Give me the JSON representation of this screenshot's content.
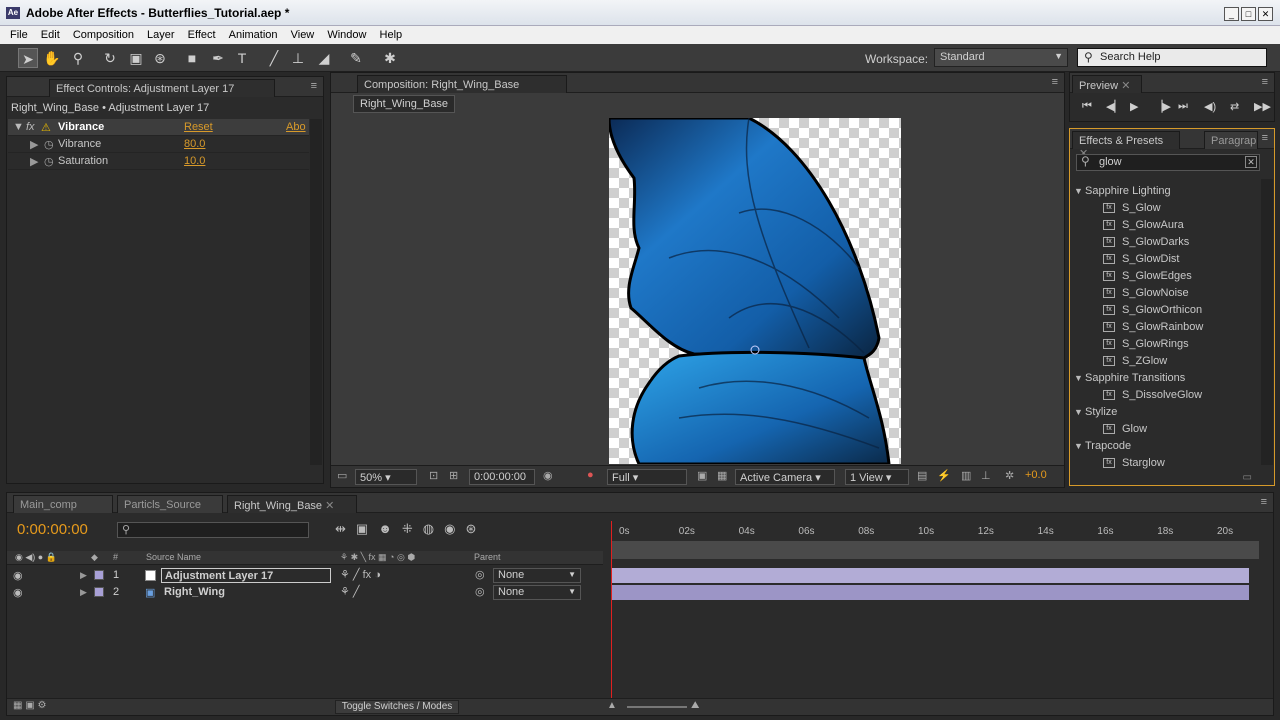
{
  "window": {
    "title": "Adobe After Effects - Butterflies_Tutorial.aep *",
    "app_icon": "Ae"
  },
  "menu": [
    "File",
    "Edit",
    "Composition",
    "Layer",
    "Effect",
    "Animation",
    "View",
    "Window",
    "Help"
  ],
  "toolbar": {
    "tools": [
      "selection-tool-icon",
      "hand-tool-icon",
      "zoom-tool-icon",
      "rotate-tool-icon",
      "camera-tool-icon",
      "pan-behind-tool-icon",
      "rectangle-tool-icon",
      "pen-tool-icon",
      "type-tool-icon",
      "brush-tool-icon",
      "clone-stamp-tool-icon",
      "eraser-tool-icon",
      "roto-brush-tool-icon",
      "puppet-pin-tool-icon"
    ],
    "workspace_label": "Workspace:",
    "workspace_value": "Standard",
    "search_placeholder": "Search Help"
  },
  "effect_controls": {
    "tab_label": "Effect Controls: Adjustment Layer 17",
    "subtitle": "Right_Wing_Base • Adjustment Layer 17",
    "effect_name": "Vibrance",
    "reset_label": "Reset",
    "about_label": "Abo",
    "params": [
      {
        "name": "Vibrance",
        "value": "80.0"
      },
      {
        "name": "Saturation",
        "value": "10.0"
      }
    ]
  },
  "composition": {
    "tab_label": "Composition: Right_Wing_Base",
    "breadcrumb": "Right_Wing_Base",
    "zoom": "50%",
    "timecode": "0:00:00:00",
    "resolution": "Full",
    "camera": "Active Camera",
    "views": "1 View",
    "exposure": "+0.0"
  },
  "preview": {
    "tab_label": "Preview"
  },
  "effects_presets": {
    "tab_label": "Effects & Presets",
    "tab2_label": "Paragrap",
    "search_value": "glow",
    "items": [
      {
        "type": "cat",
        "label": "Sapphire Lighting"
      },
      {
        "type": "eff",
        "label": "S_Glow"
      },
      {
        "type": "eff",
        "label": "S_GlowAura"
      },
      {
        "type": "eff",
        "label": "S_GlowDarks"
      },
      {
        "type": "eff",
        "label": "S_GlowDist"
      },
      {
        "type": "eff",
        "label": "S_GlowEdges"
      },
      {
        "type": "eff",
        "label": "S_GlowNoise"
      },
      {
        "type": "eff",
        "label": "S_GlowOrthicon"
      },
      {
        "type": "eff",
        "label": "S_GlowRainbow"
      },
      {
        "type": "eff",
        "label": "S_GlowRings"
      },
      {
        "type": "eff",
        "label": "S_ZGlow"
      },
      {
        "type": "cat",
        "label": "Sapphire Transitions"
      },
      {
        "type": "eff",
        "label": "S_DissolveGlow"
      },
      {
        "type": "cat",
        "label": "Stylize"
      },
      {
        "type": "eff",
        "label": "Glow"
      },
      {
        "type": "cat",
        "label": "Trapcode"
      },
      {
        "type": "eff",
        "label": "Starglow"
      }
    ]
  },
  "timeline": {
    "tabs": [
      "Main_comp",
      "Particls_Source",
      "Right_Wing_Base"
    ],
    "timecode": "0:00:00:00",
    "col_source_name": "Source Name",
    "col_parent": "Parent",
    "col_hash": "#",
    "layers": [
      {
        "num": "1",
        "name": "Adjustment Layer 17",
        "parent": "None"
      },
      {
        "num": "2",
        "name": "Right_Wing",
        "parent": "None"
      }
    ],
    "ruler": [
      "0s",
      "02s",
      "04s",
      "06s",
      "08s",
      "10s",
      "12s",
      "14s",
      "16s",
      "18s",
      "20s"
    ],
    "toggle_label": "Toggle Switches / Modes"
  },
  "colors": {
    "accent": "#e69a1c",
    "layer_bar": "#9c95c6",
    "playhead": "#e02020"
  }
}
